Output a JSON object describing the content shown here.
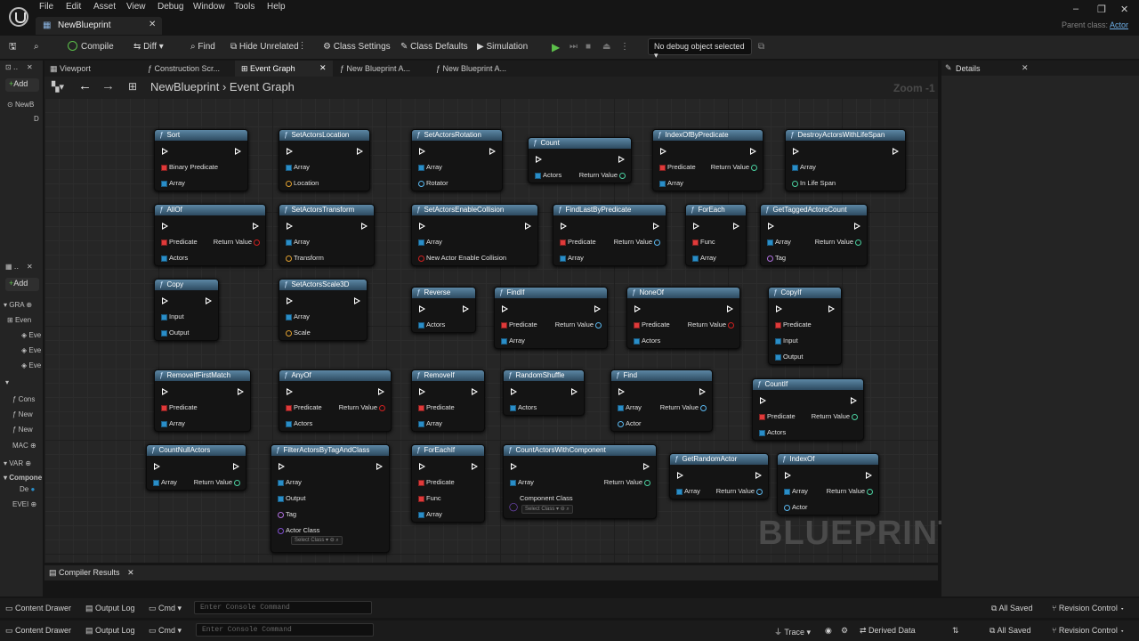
{
  "menu": [
    "File",
    "Edit",
    "Asset",
    "View",
    "Debug",
    "Window",
    "Tools",
    "Help"
  ],
  "doc_tab": "NewBlueprint",
  "parent_class_label": "Parent class:",
  "parent_class_value": "Actor",
  "toolbar": {
    "compile": "Compile",
    "diff": "Diff",
    "find": "Find",
    "hide_unrelated": "Hide Unrelated",
    "class_settings": "Class Settings",
    "class_defaults": "Class Defaults",
    "simulation": "Simulation",
    "debug_object": "No debug object selected"
  },
  "left_panel": {
    "add": "Add",
    "root": "NewB",
    "root_child": "D",
    "graphs_label": "GRA",
    "event_graph": "Even",
    "ev1": "Eve",
    "ev2": "Eve",
    "ev3": "Eve",
    "funcs": [
      "Cons",
      "New",
      "New"
    ],
    "macros_label": "MAC",
    "vars_label": "VAR",
    "components_label": "Compone",
    "comp_item": "De",
    "dispatchers_label": "EVEI"
  },
  "graph_tabs": [
    "Viewport",
    "Construction Scr...",
    "Event Graph",
    "New Blueprint A...",
    "New Blueprint A..."
  ],
  "breadcrumb_root": "NewBlueprint",
  "breadcrumb_leaf": "Event Graph",
  "zoom": "Zoom -1",
  "watermark": "BLUEPRINT",
  "details_title": "Details",
  "compiler_results": "Compiler Results",
  "nodes": {
    "n1": {
      "title": "Sort",
      "p1": "Binary Predicate",
      "p2": "Array"
    },
    "n2": {
      "title": "SetActorsLocation",
      "p1": "Array",
      "p2": "Location"
    },
    "n3": {
      "title": "SetActorsRotation",
      "p1": "Array",
      "p2": "Rotator"
    },
    "n4": {
      "title": "Count",
      "p1": "Actors",
      "o1": "Return Value"
    },
    "n5": {
      "title": "IndexOfByPredicate",
      "p1": "Predicate",
      "o1": "Return Value",
      "p2": "Array"
    },
    "n6": {
      "title": "DestroyActorsWithLifeSpan",
      "p1": "Array",
      "p2": "In Life Span"
    },
    "n7": {
      "title": "AllOf",
      "p1": "Predicate",
      "o1": "Return Value",
      "p2": "Actors"
    },
    "n8": {
      "title": "SetActorsTransform",
      "p1": "Array",
      "p2": "Transform"
    },
    "n9": {
      "title": "SetActorsEnableCollision",
      "p1": "Array",
      "p2": "New Actor Enable Collision"
    },
    "n10": {
      "title": "FindLastByPredicate",
      "p1": "Predicate",
      "o1": "Return Value",
      "p2": "Array"
    },
    "n11": {
      "title": "ForEach",
      "p1": "Func",
      "p2": "Array"
    },
    "n12": {
      "title": "GetTaggedActorsCount",
      "p1": "Array",
      "o1": "Return Value",
      "p2": "Tag"
    },
    "n13": {
      "title": "Copy",
      "p1": "Input",
      "p2": "Output"
    },
    "n14": {
      "title": "SetActorsScale3D",
      "p1": "Array",
      "p2": "Scale"
    },
    "n15": {
      "title": "Reverse",
      "p1": "Actors"
    },
    "n16": {
      "title": "FindIf",
      "p1": "Predicate",
      "o1": "Return Value",
      "p2": "Array"
    },
    "n17": {
      "title": "NoneOf",
      "p1": "Predicate",
      "o1": "Return Value",
      "p2": "Actors"
    },
    "n18": {
      "title": "CopyIf",
      "p1": "Predicate",
      "p2": "Input",
      "p3": "Output"
    },
    "n19": {
      "title": "RemoveIfFirstMatch",
      "p1": "Predicate",
      "p2": "Array"
    },
    "n20": {
      "title": "AnyOf",
      "p1": "Predicate",
      "o1": "Return Value",
      "p2": "Actors"
    },
    "n21": {
      "title": "RemoveIf",
      "p1": "Predicate",
      "p2": "Array"
    },
    "n22": {
      "title": "RandomShuffle",
      "p1": "Actors"
    },
    "n23": {
      "title": "Find",
      "p1": "Array",
      "o1": "Return Value",
      "p2": "Actor"
    },
    "n24": {
      "title": "CountIf",
      "p1": "Predicate",
      "o1": "Return Value",
      "p2": "Actors"
    },
    "n25": {
      "title": "CountNullActors",
      "p1": "Array",
      "o1": "Return Value"
    },
    "n26": {
      "title": "FilterActorsByTagAndClass",
      "p1": "Array",
      "p2": "Output",
      "p3": "Tag",
      "p4": "Actor Class",
      "sel": "Select Class"
    },
    "n27": {
      "title": "ForEachIf",
      "p1": "Predicate",
      "p2": "Func",
      "p3": "Array"
    },
    "n28": {
      "title": "CountActorsWithComponent",
      "p1": "Array",
      "o1": "Return Value",
      "p2": "Component Class",
      "sel": "Select Class"
    },
    "n29": {
      "title": "GetRandomActor",
      "p1": "Array",
      "o1": "Return Value"
    },
    "n30": {
      "title": "IndexOf",
      "p1": "Array",
      "o1": "Return Value",
      "p2": "Actor"
    }
  },
  "statusbar": {
    "content_drawer": "Content Drawer",
    "output_log": "Output Log",
    "cmd": "Cmd",
    "console_placeholder": "Enter Console Command",
    "all_saved": "All Saved",
    "revision_control": "Revision Control",
    "trace": "Trace",
    "derived_data": "Derived Data"
  }
}
